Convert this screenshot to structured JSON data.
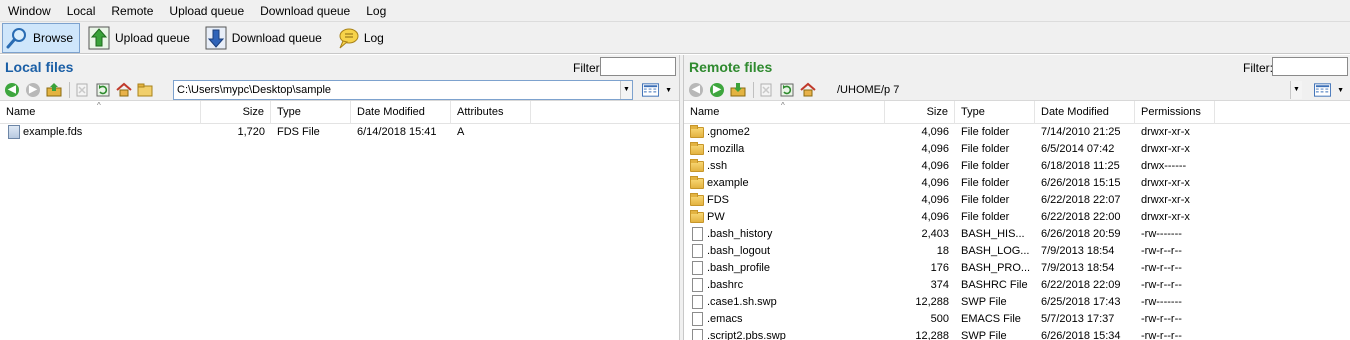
{
  "menu": [
    "Window",
    "Local",
    "Remote",
    "Upload queue",
    "Download queue",
    "Log"
  ],
  "toolbar": {
    "browse": "Browse",
    "upload_queue": "Upload queue",
    "download_queue": "Download queue",
    "log": "Log"
  },
  "local": {
    "title": "Local files",
    "filter_label": "Filter:",
    "filter_value": "",
    "path": "C:\\Users\\mypc\\Desktop\\sample",
    "columns": [
      "Name",
      "Size",
      "Type",
      "Date Modified",
      "Attributes"
    ],
    "rows": [
      {
        "name": "example.fds",
        "size": "1,720",
        "type": "FDS File",
        "date": "6/14/2018 15:41",
        "attr": "A",
        "icon": "fds-file-icon"
      }
    ]
  },
  "remote": {
    "title": "Remote files",
    "filter_label": "Filter:",
    "filter_value": "",
    "path": "/UHOME/p                7",
    "columns": [
      "Name",
      "Size",
      "Type",
      "Date Modified",
      "Permissions"
    ],
    "rows": [
      {
        "name": ".gnome2",
        "size": "4,096",
        "type": "File folder",
        "date": "7/14/2010 21:25",
        "perm": "drwxr-xr-x",
        "icon": "folder"
      },
      {
        "name": ".mozilla",
        "size": "4,096",
        "type": "File folder",
        "date": "6/5/2014 07:42",
        "perm": "drwxr-xr-x",
        "icon": "folder"
      },
      {
        "name": ".ssh",
        "size": "4,096",
        "type": "File folder",
        "date": "6/18/2018 11:25",
        "perm": "drwx------",
        "icon": "folder"
      },
      {
        "name": "example",
        "size": "4,096",
        "type": "File folder",
        "date": "6/26/2018 15:15",
        "perm": "drwxr-xr-x",
        "icon": "folder"
      },
      {
        "name": "FDS",
        "size": "4,096",
        "type": "File folder",
        "date": "6/22/2018 22:07",
        "perm": "drwxr-xr-x",
        "icon": "folder"
      },
      {
        "name": "PW",
        "size": "4,096",
        "type": "File folder",
        "date": "6/22/2018 22:00",
        "perm": "drwxr-xr-x",
        "icon": "folder"
      },
      {
        "name": ".bash_history",
        "size": "2,403",
        "type": "BASH_HIS...",
        "date": "6/26/2018 20:59",
        "perm": "-rw-------",
        "icon": "file"
      },
      {
        "name": ".bash_logout",
        "size": "18",
        "type": "BASH_LOG...",
        "date": "7/9/2013 18:54",
        "perm": "-rw-r--r--",
        "icon": "file"
      },
      {
        "name": ".bash_profile",
        "size": "176",
        "type": "BASH_PRO...",
        "date": "7/9/2013 18:54",
        "perm": "-rw-r--r--",
        "icon": "file"
      },
      {
        "name": ".bashrc",
        "size": "374",
        "type": "BASHRC File",
        "date": "6/22/2018 22:09",
        "perm": "-rw-r--r--",
        "icon": "file"
      },
      {
        "name": ".case1.sh.swp",
        "size": "12,288",
        "type": "SWP File",
        "date": "6/25/2018 17:43",
        "perm": "-rw-------",
        "icon": "file"
      },
      {
        "name": ".emacs",
        "size": "500",
        "type": "EMACS File",
        "date": "5/7/2013 17:37",
        "perm": "-rw-r--r--",
        "icon": "file"
      },
      {
        "name": ".script2.pbs.swp",
        "size": "12,288",
        "type": "SWP File",
        "date": "6/26/2018 15:34",
        "perm": "-rw-r--r--",
        "icon": "file"
      }
    ]
  }
}
